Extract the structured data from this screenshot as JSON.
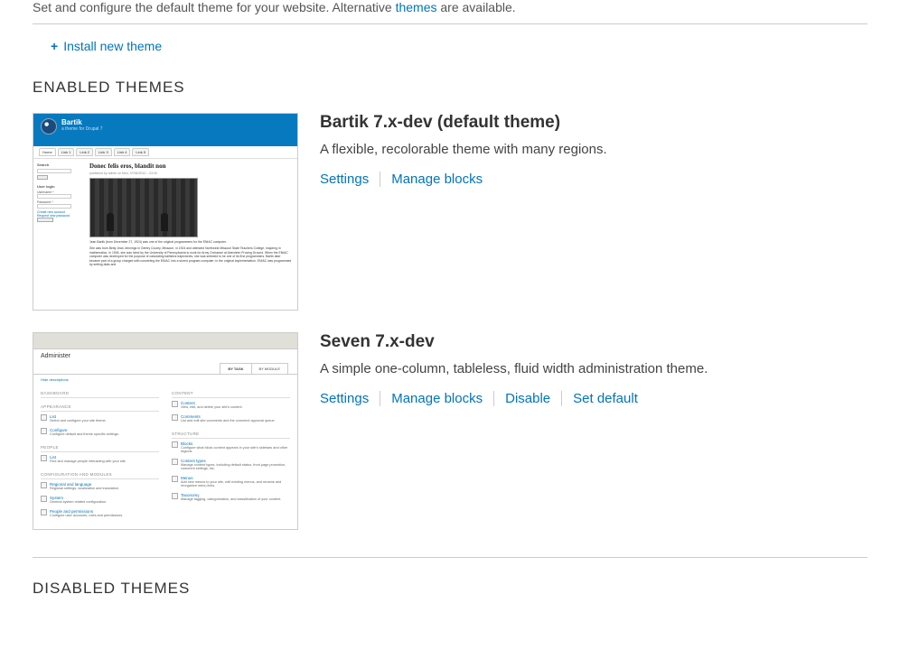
{
  "intro": {
    "prefix": "Set and configure the default theme for your website. Alternative ",
    "link": "themes",
    "suffix": " are available."
  },
  "install_link": "Install new theme",
  "sections": {
    "enabled": "ENABLED THEMES",
    "disabled": "DISABLED THEMES"
  },
  "themes": [
    {
      "title": "Bartik 7.x-dev (default theme)",
      "description": "A flexible, recolorable theme with many regions.",
      "actions": {
        "settings": "Settings",
        "manage_blocks": "Manage blocks"
      }
    },
    {
      "title": "Seven 7.x-dev",
      "description": "A simple one-column, tableless, fluid width administration theme.",
      "actions": {
        "settings": "Settings",
        "manage_blocks": "Manage blocks",
        "disable": "Disable",
        "set_default": "Set default"
      }
    }
  ],
  "bartik_thumb": {
    "site": "Bartik",
    "slogan": "a theme for Drupal 7",
    "home": "Home",
    "links": [
      "Link 1",
      "Link 2",
      "Link 3",
      "Link 4",
      "Link 5"
    ],
    "search": "Search",
    "login_title": "User login",
    "username": "Username *",
    "password": "Password *",
    "create": "Create new account",
    "request": "Request new password",
    "login_btn": "Log in",
    "headline": "Donec felis eros, blandit non",
    "meta": "published by admin on Mon, 07/06/2010 – 03:30",
    "p1": "Jean Bartik (born December 27, 1924) was one of the original programmers for the ENIAC computer.",
    "p2": "She was born Betty Jean Jennings in Gentry County, Missouri, in 1924 and attended Northwest Missouri State Teachers College, majoring in mathematics. In 1945, she was hired by the University of Pennsylvania to work for Army Ordnance at Aberdeen Proving Ground. When the ENIAC computer was developed for the purpose of calculating ballistics trajectories, she was selected to be one of its first programmers. Bartik later became part of a group charged with converting the ENIAC into a stored program computer; in the original implementation, ENIAC was programmed by setting dials and"
  },
  "seven_thumb": {
    "page": "Administer",
    "tabs": {
      "task": "BY TASK",
      "module": "BY MODULE"
    },
    "hide": "Hide descriptions",
    "left": [
      {
        "cat": "DASHBOARD"
      },
      {
        "cat": "APPEARANCE",
        "items": [
          {
            "t": "List",
            "d": "Select and configure your site theme."
          },
          {
            "t": "Configure",
            "d": "Configure default and theme specific settings."
          }
        ]
      },
      {
        "cat": "PEOPLE",
        "items": [
          {
            "t": "List",
            "d": "Find and manage people interacting with your site."
          }
        ]
      },
      {
        "cat": "CONFIGURATION AND MODULES",
        "items": [
          {
            "t": "Regional and language",
            "d": "Regional settings, localization and translation."
          },
          {
            "t": "System",
            "d": "General system related configuration."
          },
          {
            "t": "People and permissions",
            "d": "Configure user accounts, roles and permissions."
          }
        ]
      }
    ],
    "right": [
      {
        "cat": "CONTENT",
        "items": [
          {
            "t": "Content",
            "d": "View, edit, and delete your site's content."
          },
          {
            "t": "Comments",
            "d": "List and edit site comments and the comment approval queue."
          }
        ]
      },
      {
        "cat": "STRUCTURE",
        "items": [
          {
            "t": "Blocks",
            "d": "Configure what block content appears in your site's sidebars and other regions."
          },
          {
            "t": "Content types",
            "d": "Manage content types, including default status, front page promotion, comment settings, etc."
          },
          {
            "t": "Menus",
            "d": "Add new menus to your site, edit existing menus, and rename and reorganize menu links."
          },
          {
            "t": "Taxonomy",
            "d": "Manage tagging, categorization, and classification of your content."
          }
        ]
      }
    ]
  }
}
